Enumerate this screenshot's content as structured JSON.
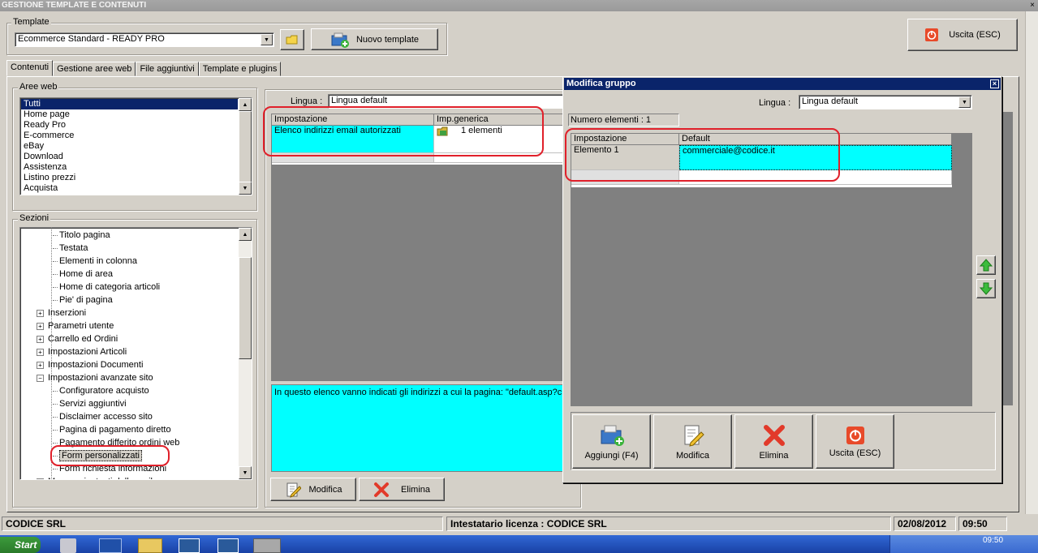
{
  "window": {
    "title": "GESTIONE TEMPLATE E CONTENUTI",
    "close": "×"
  },
  "template": {
    "group_label": "Template",
    "selected": "Ecommerce Standard - READY PRO",
    "new_button": "Nuovo template",
    "exit_button": "Uscita (ESC)"
  },
  "tabs": [
    "Contenuti",
    "Gestione aree web",
    "File aggiuntivi",
    "Template e plugins"
  ],
  "aree_web": {
    "label": "Aree web",
    "items": [
      "Tutti",
      "Home page",
      "Ready Pro",
      "E-commerce",
      "eBay",
      "Download",
      "Assistenza",
      "Listino prezzi",
      "Acquista"
    ]
  },
  "sezioni": {
    "label": "Sezioni",
    "items": [
      {
        "label": "Titolo pagina",
        "level": 2
      },
      {
        "label": "Testata",
        "level": 2
      },
      {
        "label": "Elementi in colonna",
        "level": 2
      },
      {
        "label": "Home di area",
        "level": 2
      },
      {
        "label": "Home di categoria articoli",
        "level": 2
      },
      {
        "label": "Pie' di pagina",
        "level": 2
      },
      {
        "label": "Inserzioni",
        "level": 1,
        "expander": "+"
      },
      {
        "label": "Parametri utente",
        "level": 1,
        "expander": "+"
      },
      {
        "label": "Carrello ed Ordini",
        "level": 1,
        "expander": "+"
      },
      {
        "label": "Impostazioni Articoli",
        "level": 1,
        "expander": "+"
      },
      {
        "label": "Impostazioni Documenti",
        "level": 1,
        "expander": "+"
      },
      {
        "label": "Impostazioni avanzate sito",
        "level": 1,
        "expander": "−"
      },
      {
        "label": "Configuratore acquisto",
        "level": 2
      },
      {
        "label": "Servizi aggiuntivi",
        "level": 2
      },
      {
        "label": "Disclaimer accesso sito",
        "level": 2
      },
      {
        "label": "Pagina di pagamento diretto",
        "level": 2
      },
      {
        "label": "Pagamento differito ordini web",
        "level": 2
      },
      {
        "label": "Form personalizzati",
        "level": 2,
        "selected": true
      },
      {
        "label": "Form richiesta informazioni",
        "level": 2
      },
      {
        "label": "Messaggi e testi della mail",
        "level": 1,
        "expander": "+"
      }
    ]
  },
  "main": {
    "lingua_label": "Lingua :",
    "lingua_value": "Lingua default",
    "grid_headers": [
      "Impostazione",
      "Imp.generica"
    ],
    "row": {
      "setting": "Elenco indirizzi email autorizzati",
      "value": "1 elementi"
    },
    "description": "In questo elenco vanno indicati gli indirizzi a cui la pagina: \"default.asp?cm",
    "modify_button": "Modifica",
    "delete_button": "Elimina"
  },
  "dialog": {
    "title": "Modifica gruppo",
    "close": "×",
    "lingua_label": "Lingua :",
    "lingua_value": "Lingua default",
    "count": "Numero elementi : 1",
    "headers": [
      "Impostazione",
      "Default"
    ],
    "row": {
      "setting": "Elemento 1",
      "value": "commerciale@codice.it"
    },
    "buttons": {
      "add": "Aggiungi (F4)",
      "modify": "Modifica",
      "delete": "Elimina",
      "exit": "Uscita (ESC)"
    }
  },
  "status": {
    "company": "CODICE SRL",
    "license": "Intestatario licenza : CODICE SRL",
    "date": "02/08/2012",
    "time": "09:50"
  },
  "taskbar": {
    "start": "Start",
    "clock": "09:50"
  },
  "colors": {
    "cyan": "#00ffff",
    "highlight": "#0a246a",
    "annotation": "#e0202a",
    "dialog_title": "#0a246a"
  }
}
